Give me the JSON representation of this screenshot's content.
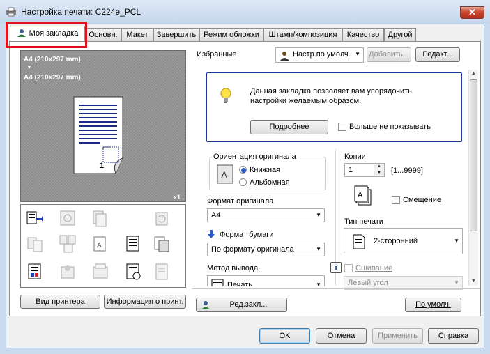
{
  "window": {
    "title": "Настройка печати: C224e_PCL",
    "close_glyph": "✕"
  },
  "tabs": [
    {
      "label": "Моя закладка",
      "active": true
    },
    {
      "label": "Основн."
    },
    {
      "label": "Макет"
    },
    {
      "label": "Завершить"
    },
    {
      "label": "Режим обложки"
    },
    {
      "label": "Штамп/композиция"
    },
    {
      "label": "Качество"
    },
    {
      "label": "Другой"
    }
  ],
  "preview": {
    "paper_line1": "A4 (210x297 mm)",
    "arrow": "▼",
    "paper_line2": "A4 (210x297 mm)",
    "page_number": "1",
    "copies_indicator": "x1"
  },
  "left_buttons": {
    "printer_view": "Вид принтера",
    "printer_info": "Информация о принт."
  },
  "favorites": {
    "label": "Избранные",
    "selected": "Настр.по умолч.",
    "add_button": "Добавить...",
    "edit_button": "Редакт..."
  },
  "info": {
    "text_line1": "Данная закладка позволяет вам упорядочить",
    "text_line2": "настройки желаемым образом.",
    "details_button": "Подробнее",
    "dont_show_label": "Больше не показывать"
  },
  "orientation": {
    "label": "Ориентация оригинала",
    "options": [
      {
        "label": "Книжная",
        "selected": true
      },
      {
        "label": "Альбомная",
        "selected": false
      }
    ]
  },
  "copies": {
    "label": "Копии",
    "value": "1",
    "range": "[1...9999]",
    "offset_label": "Смещение"
  },
  "original_size": {
    "label": "Формат оригинала",
    "value": "A4"
  },
  "paper_size": {
    "label": "Формат бумаги",
    "value": "По формату оригинала"
  },
  "print_type": {
    "label": "Тип печати",
    "value": "2-сторонний"
  },
  "output_method": {
    "label": "Метод вывода",
    "value": "Печать"
  },
  "binding": {
    "label": "Сшивание",
    "value": "Левый угол"
  },
  "bottom_panel": {
    "edit_tab_button": "Ред.закл...",
    "default_button": "По умолч."
  },
  "dialog_buttons": {
    "ok": "OK",
    "cancel": "Отмена",
    "apply": "Применить",
    "help": "Справка"
  }
}
